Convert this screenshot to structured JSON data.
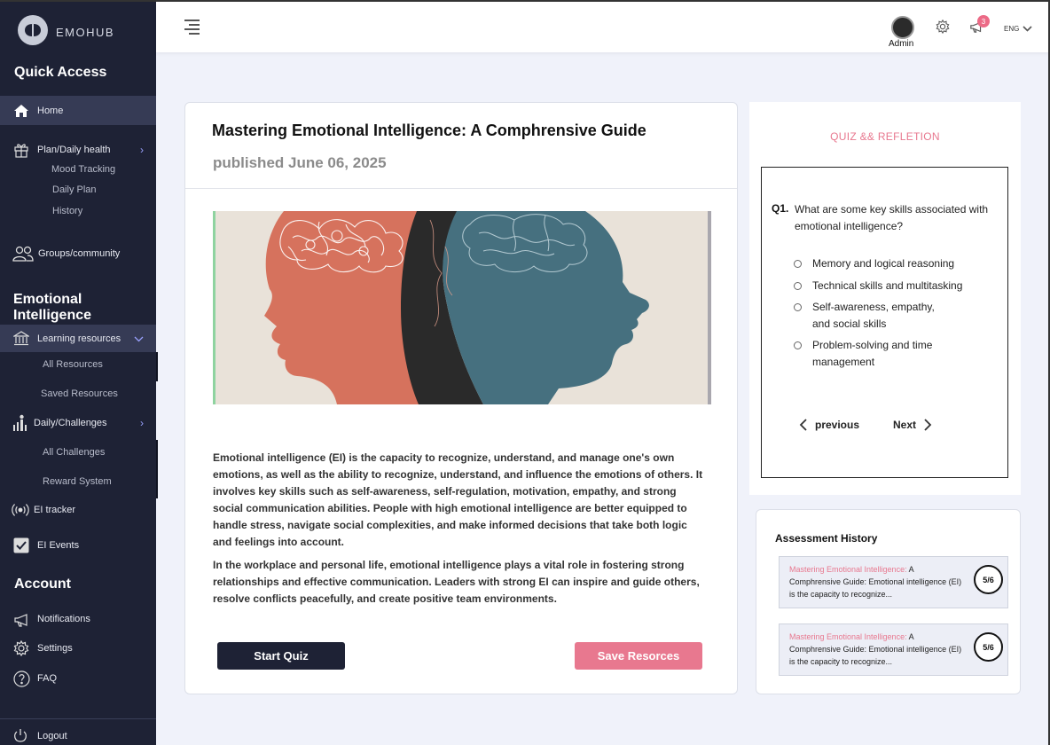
{
  "brand": {
    "name": "EMOHUB"
  },
  "sidebar": {
    "quick_access_title": "Quick Access",
    "home": "Home",
    "plan": "Plan/Daily health",
    "plan_sub": [
      "Mood Tracking",
      "Daily Plan",
      "History"
    ],
    "groups": "Groups/community",
    "ei_title": "Emotional Intelligence",
    "learning": "Learning resources",
    "learning_sub": [
      "All Resources",
      "Saved Resources"
    ],
    "challenges": "Daily/Challenges",
    "challenges_sub": [
      "All Challenges",
      "Reward System"
    ],
    "ei_tracker": "EI tracker",
    "ei_events": "EI Events",
    "account_title": "Account",
    "notifications": "Notifications",
    "settings": "Settings",
    "faq": "FAQ",
    "logout": "Logout"
  },
  "header": {
    "user_label": "Admin",
    "cart_badge": "3",
    "language": "ENG"
  },
  "article": {
    "title": "Mastering Emotional Intelligence: A Comphrensive Guide",
    "date": "published June 06, 2025",
    "paragraph1": "Emotional intelligence (EI) is the capacity to recognize, understand, and manage one's own emotions, as well as the ability to recognize, understand, and influence the emotions of others. It involves key skills such as self-awareness, self-regulation, motivation, empathy, and strong social communication abilities. People with high emotional intelligence are better equipped to handle stress, navigate social complexities, and make informed decisions that take both logic and feelings into account.",
    "paragraph2": "In the workplace and personal life, emotional intelligence plays a vital role in fostering strong relationships and effective communication. Leaders with strong EI can inspire and guide others, resolve conflicts peacefully, and create positive team environments.",
    "start_quiz": "Start Quiz",
    "save_resources": "Save Resorces"
  },
  "quiz": {
    "title": "QUIZ && REFLETION",
    "q_num": "Q1.",
    "question": "What are some key skills associated with emotional intelligence?",
    "options": [
      "Memory and logical reasoning",
      "Technical skills and multitasking",
      "Self-awareness, empathy, and social skills",
      "Problem-solving and time management"
    ],
    "previous": "previous",
    "next": "Next"
  },
  "history": {
    "title": "Assessment History",
    "items": [
      {
        "highlight": "Mastering Emotional Intelligence:",
        "text": " A Comphrensive Guide: Emotional intelligence (EI) is the capacity to recognize...",
        "score": "5/6"
      },
      {
        "highlight": "Mastering Emotional Intelligence:",
        "text": " A Comphrensive Guide: Emotional intelligence (EI) is the capacity to recognize...",
        "score": "5/6"
      }
    ]
  },
  "colors": {
    "sidebar_bg": "#1e2235",
    "accent_pink": "#e8788f",
    "page_bg": "#f0f2fa"
  }
}
